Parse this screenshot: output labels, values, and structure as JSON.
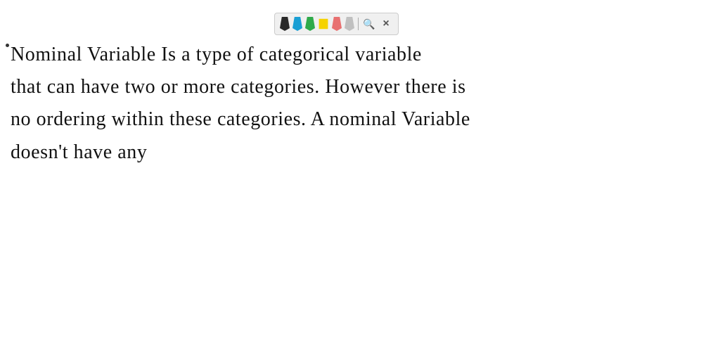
{
  "toolbar": {
    "pens": [
      {
        "color": "#2a2a2a",
        "name": "black-pen"
      },
      {
        "color": "#1a6fc4",
        "name": "blue-pen"
      },
      {
        "color": "#2eaa4a",
        "name": "green-pen"
      },
      {
        "color": "#f5d300",
        "name": "yellow-pen"
      },
      {
        "color": "#e87070",
        "name": "pink-pen"
      },
      {
        "color": "#aaaaaa",
        "name": "gray-pen"
      }
    ],
    "search_icon": "🔍",
    "close_icon": "×"
  },
  "content": {
    "line1": "Nominal Variable   Is a  type  of  categorical  variable",
    "line2": "that  can  have   two    or  more    categories.  However there is",
    "line3": "no    ordering  within   these   categories.   A  nominal  Variable",
    "line4": "doesn't  have  any"
  },
  "dot": true
}
